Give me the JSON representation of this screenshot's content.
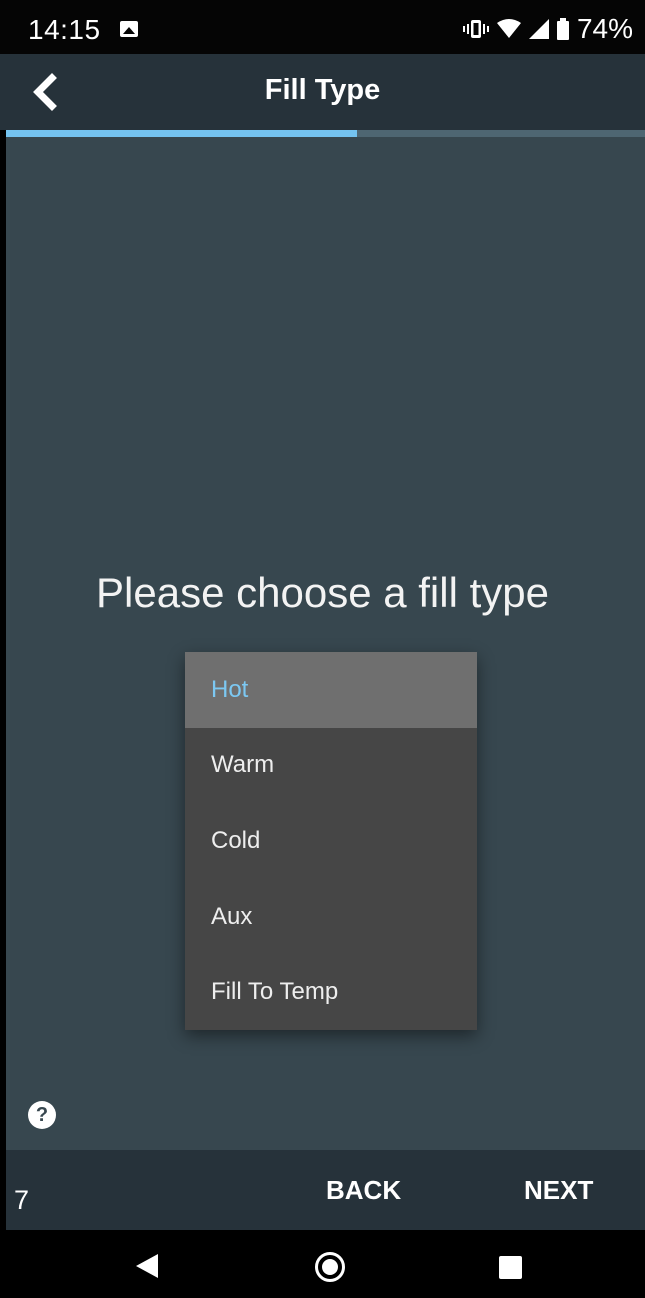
{
  "status_bar": {
    "time": "14:15",
    "battery": "74%",
    "icons": [
      "photo-icon",
      "vibrate-icon",
      "wifi-icon",
      "signal-icon",
      "battery-icon"
    ]
  },
  "app_bar": {
    "title": "Fill Type",
    "back_icon": "chevron-left-icon"
  },
  "progress": {
    "fraction": 0.55
  },
  "main": {
    "prompt": "Please choose a fill type",
    "dropdown": {
      "selected_index": 0,
      "options": [
        "Hot",
        "Warm",
        "Cold",
        "Aux",
        "Fill To Temp"
      ]
    }
  },
  "bottom_bar": {
    "step": "7",
    "back_label": "BACK",
    "next_label": "NEXT",
    "help_glyph": "?"
  },
  "nav_bar": {
    "icons": [
      "nav-back-icon",
      "nav-home-icon",
      "nav-recent-icon"
    ]
  },
  "colors": {
    "accent": "#74c3f0",
    "main_bg": "#37474f",
    "bar_bg": "#26323a",
    "menu_bg": "#464646",
    "menu_selected_bg": "#6f6f6f"
  }
}
